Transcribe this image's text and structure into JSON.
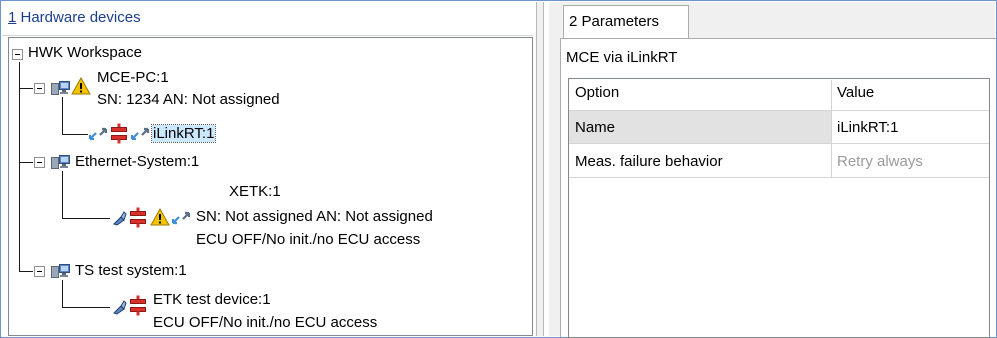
{
  "hardware_pane": {
    "title_number": "1",
    "title_text": " Hardware devices",
    "tree": {
      "workspace": "HWK Workspace",
      "mce_pc": "MCE-PC:1",
      "mce_pc_sn": "SN: 1234 AN: Not assigned",
      "ilinkrt": "iLinkRT:1",
      "ethernet_system": "Ethernet-System:1",
      "xetk": "XETK:1",
      "xetk_sn": "SN: Not assigned AN: Not assigned",
      "xetk_status": "ECU OFF/No init./no ECU access",
      "ts_test_system": "TS test system:1",
      "etk_test_device": "ETK test device:1",
      "etk_status": "ECU OFF/No init./no ECU access"
    }
  },
  "parameters_pane": {
    "tab_label": "2 Parameters",
    "caption": "MCE via iLinkRT",
    "columns": {
      "option": "Option",
      "value": "Value"
    },
    "rows": [
      {
        "option": "Name",
        "value": "iLinkRT:1",
        "disabled": false
      },
      {
        "option": "Meas. failure behavior",
        "value": "Retry always",
        "disabled": true
      }
    ]
  },
  "icons": {
    "expand_toggle": "minus-box-icon",
    "system": "computer-system-icon",
    "warning": "warning-triangle-icon",
    "connection": "connection-arrows-icon",
    "port": "port-connector-icon",
    "device": "ecu-device-icon"
  },
  "colors": {
    "title_link": "#1b3f8f",
    "selection": "#cce8ff",
    "warning": "#f3c300",
    "connector": "#d9302b",
    "arrows": "#3f8fd6"
  }
}
